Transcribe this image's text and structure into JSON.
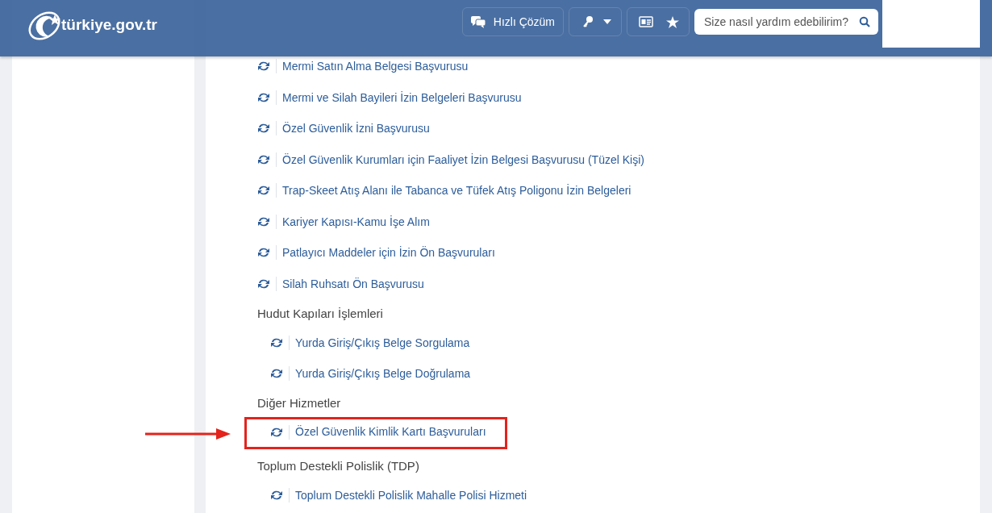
{
  "header": {
    "logo": "türkiye.gov.tr",
    "quick_button": "Hızlı Çözüm",
    "search": {
      "placeholder": "Size nasıl yardım edebilirim?"
    }
  },
  "services": [
    {
      "kind": "link",
      "label": "Mermi Satın Alma Belgesi Başvurusu"
    },
    {
      "kind": "link",
      "label": "Mermi ve Silah Bayileri İzin Belgeleri Başvurusu"
    },
    {
      "kind": "link",
      "label": "Özel Güvenlik İzni Başvurusu"
    },
    {
      "kind": "link",
      "label": "Özel Güvenlik Kurumları için Faaliyet İzin Belgesi Başvurusu (Tüzel Kişi)"
    },
    {
      "kind": "link",
      "label": "Trap-Skeet Atış Alanı ile Tabanca ve Tüfek Atış Poligonu İzin Belgeleri"
    },
    {
      "kind": "link",
      "label": "Kariyer Kapısı-Kamu İşe Alım"
    },
    {
      "kind": "link",
      "label": "Patlayıcı Maddeler için İzin Ön Başvuruları"
    },
    {
      "kind": "link",
      "label": "Silah Ruhsatı Ön Başvurusu"
    },
    {
      "kind": "heading",
      "label": "Hudut Kapıları İşlemleri",
      "children": [
        {
          "label": "Yurda Giriş/Çıkış Belge Sorgulama",
          "highlighted": false
        },
        {
          "label": "Yurda Giriş/Çıkış Belge Doğrulama",
          "highlighted": false
        }
      ]
    },
    {
      "kind": "heading",
      "label": "Diğer Hizmetler",
      "children": [
        {
          "label": "Özel Güvenlik Kimlik Kartı Başvuruları",
          "highlighted": true
        }
      ]
    },
    {
      "kind": "heading",
      "label": "Toplum Destekli Polislik (TDP)",
      "children": [
        {
          "label": "Toplum Destekli Polislik Mahalle Polisi Hizmeti",
          "highlighted": false
        }
      ]
    }
  ]
}
